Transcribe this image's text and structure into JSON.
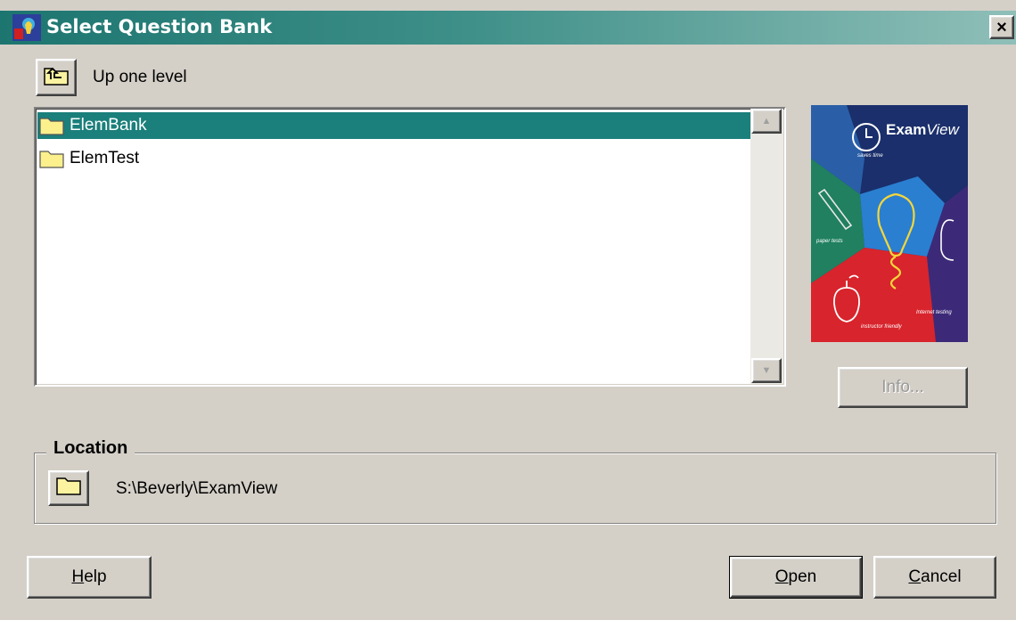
{
  "window": {
    "title": "Select Question Bank",
    "close_label": "×"
  },
  "toolbar": {
    "up_label": "Up one level"
  },
  "file_list": {
    "items": [
      {
        "name": "ElemBank",
        "selected": true
      },
      {
        "name": "ElemTest",
        "selected": false
      }
    ]
  },
  "logo": {
    "brand_exam": "Exam",
    "brand_view": "View",
    "captions": [
      "saves time",
      "paper tests",
      "Internet testing",
      "instructor friendly"
    ]
  },
  "info_button": {
    "label": "Info..."
  },
  "location": {
    "label": "Location",
    "path": "S:\\Beverly\\ExamView"
  },
  "buttons": {
    "help_key": "H",
    "help_rest": "elp",
    "open_key": "O",
    "open_rest": "pen",
    "cancel_key": "C",
    "cancel_rest": "ancel"
  },
  "colors": {
    "selection": "#1b7f7b",
    "title_start": "#1d7570",
    "face": "#d4d0c8"
  }
}
